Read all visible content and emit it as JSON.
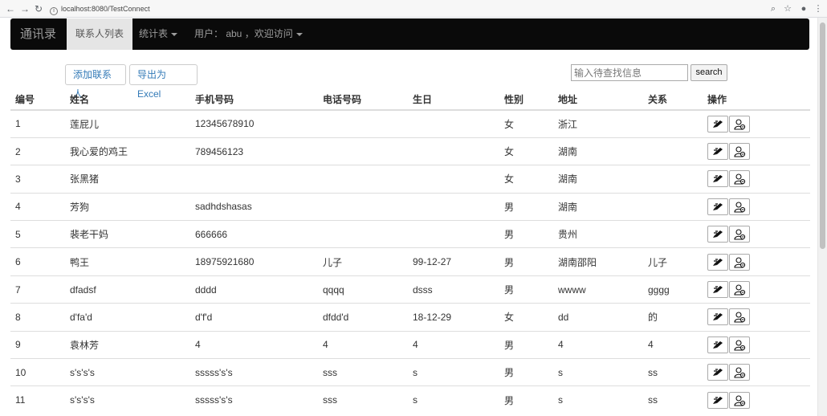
{
  "browser": {
    "url": "localhost:8080/TestConnect"
  },
  "navbar": {
    "brand": "通讯录",
    "items": [
      {
        "label": "联系人列表"
      },
      {
        "label": "统计表"
      },
      {
        "label": "用户： abu ，欢迎访问"
      }
    ]
  },
  "toolbar": {
    "add_label": "添加联系人",
    "export_label": "导出为Excel",
    "search_placeholder": "输入待查找信息",
    "search_label": "search"
  },
  "table": {
    "headers": [
      "编号",
      "姓名",
      "手机号码",
      "电话号码",
      "生日",
      "性别",
      "地址",
      "关系",
      "操作"
    ],
    "rows": [
      [
        "1",
        "莲屁儿",
        "12345678910",
        "",
        "",
        "女",
        "浙江",
        ""
      ],
      [
        "2",
        "我心爱的鸡王",
        "789456123",
        "",
        "",
        "女",
        "湖南",
        ""
      ],
      [
        "3",
        "张黑猪",
        "",
        "",
        "",
        "女",
        "湖南",
        ""
      ],
      [
        "4",
        "芳狗",
        "sadhdshasas",
        "",
        "",
        "男",
        "湖南",
        ""
      ],
      [
        "5",
        "裴老干妈",
        "666666",
        "",
        "",
        "男",
        "贵州",
        ""
      ],
      [
        "6",
        "鸭王",
        "18975921680",
        "儿子",
        "99-12-27",
        "男",
        "湖南邵阳",
        "儿子"
      ],
      [
        "7",
        "dfadsf",
        "dddd",
        "qqqq",
        "dsss",
        "男",
        "wwww",
        "gggg"
      ],
      [
        "8",
        "d'fa'd",
        "d'f'd",
        "dfdd'd",
        "18-12-29",
        "女",
        "dd",
        "的"
      ],
      [
        "9",
        "袁林芳",
        "4",
        "4",
        "4",
        "男",
        "4",
        "4"
      ],
      [
        "10",
        "s's's's",
        "sssss's's",
        "sss",
        "s",
        "男",
        "s",
        "ss"
      ],
      [
        "11",
        "s's's's",
        "sssss's's",
        "sss",
        "s",
        "男",
        "s",
        "ss"
      ]
    ]
  },
  "icons": {
    "edit": "edit-pen-icon",
    "delete": "delete-user-icon"
  }
}
